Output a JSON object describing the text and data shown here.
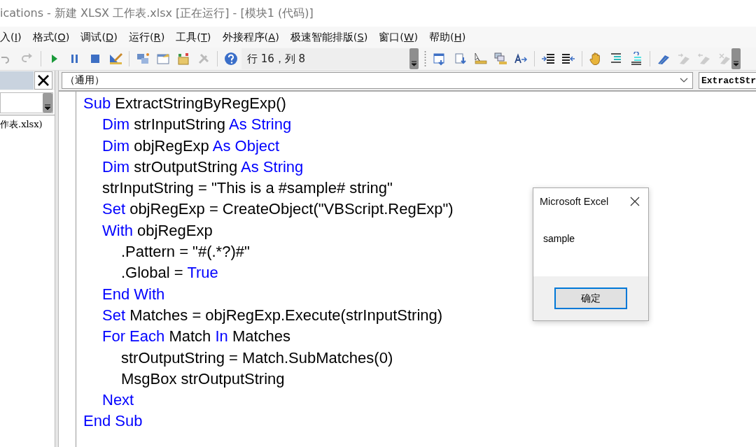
{
  "window": {
    "title": "ications - 新建 XLSX 工作表.xlsx [正在运行] - [模块1 (代码)]"
  },
  "menu": [
    {
      "before": "入(",
      "key": "I",
      "after": ")"
    },
    {
      "before": "格式(",
      "key": "O",
      "after": ")"
    },
    {
      "before": "调试(",
      "key": "D",
      "after": ")"
    },
    {
      "before": "运行(",
      "key": "R",
      "after": ")"
    },
    {
      "before": "工具(",
      "key": "T",
      "after": ")"
    },
    {
      "before": "外接程序(",
      "key": "A",
      "after": ")"
    },
    {
      "before": "极速智能排版(",
      "key": "S",
      "after": ")"
    },
    {
      "before": "窗口(",
      "key": "W",
      "after": ")"
    },
    {
      "before": "帮助(",
      "key": "H",
      "after": ")"
    }
  ],
  "toolbar": {
    "status": "行 16，列 8"
  },
  "project_panel": {
    "tree_items": [
      "作表.xlsx)"
    ]
  },
  "code_window": {
    "object_combo": "（通用）",
    "procedure_combo": "ExtractStr",
    "lines": [
      {
        "tokens": [
          {
            "text": "Sub",
            "kind": "keyword"
          },
          {
            "text": " ExtractStringByRegExp()",
            "kind": "plain"
          }
        ],
        "children": [
          {
            "tokens": [
              {
                "text": "Dim",
                "kind": "keyword"
              },
              {
                "text": " strInputString ",
                "kind": "plain"
              },
              {
                "text": "As String",
                "kind": "keyword"
              }
            ]
          },
          {
            "tokens": [
              {
                "text": "Dim",
                "kind": "keyword"
              },
              {
                "text": " objRegExp ",
                "kind": "plain"
              },
              {
                "text": "As Object",
                "kind": "keyword"
              }
            ]
          },
          {
            "tokens": [
              {
                "text": "Dim",
                "kind": "keyword"
              },
              {
                "text": " strOutputString ",
                "kind": "plain"
              },
              {
                "text": "As String",
                "kind": "keyword"
              }
            ]
          },
          {
            "tokens": [
              {
                "text": "strInputString = \"This is a #sample# string\"",
                "kind": "plain"
              }
            ]
          },
          {
            "tokens": [
              {
                "text": "Set",
                "kind": "keyword"
              },
              {
                "text": " objRegExp = CreateObject(\"VBScript.RegExp\")",
                "kind": "plain"
              }
            ]
          },
          {
            "tokens": [
              {
                "text": "With",
                "kind": "keyword"
              },
              {
                "text": " objRegExp",
                "kind": "plain"
              }
            ],
            "children": [
              {
                "tokens": [
                  {
                    "text": ".Pattern = \"#(.*?)#\"",
                    "kind": "plain"
                  }
                ]
              },
              {
                "tokens": [
                  {
                    "text": ".Global = ",
                    "kind": "plain"
                  },
                  {
                    "text": "True",
                    "kind": "keyword"
                  }
                ]
              }
            ]
          },
          {
            "tokens": [
              {
                "text": "End With",
                "kind": "keyword"
              }
            ]
          },
          {
            "tokens": [
              {
                "text": "Set",
                "kind": "keyword"
              },
              {
                "text": " Matches = objRegExp.Execute(strInputString)",
                "kind": "plain"
              }
            ]
          },
          {
            "tokens": [
              {
                "text": "For Each",
                "kind": "keyword"
              },
              {
                "text": " Match ",
                "kind": "plain"
              },
              {
                "text": "In",
                "kind": "keyword"
              },
              {
                "text": " Matches",
                "kind": "plain"
              }
            ],
            "children": [
              {
                "tokens": [
                  {
                    "text": "strOutputString = Match.SubMatches(0)",
                    "kind": "plain"
                  }
                ]
              },
              {
                "tokens": [
                  {
                    "text": "MsgBox strOutputString",
                    "kind": "plain"
                  }
                ]
              }
            ]
          },
          {
            "tokens": [
              {
                "text": "Next",
                "kind": "keyword"
              }
            ]
          }
        ]
      },
      {
        "tokens": [
          {
            "text": "End Sub",
            "kind": "keyword"
          }
        ]
      }
    ]
  },
  "dialog": {
    "title": "Microsoft Excel",
    "message": "sample",
    "button": "确定"
  }
}
